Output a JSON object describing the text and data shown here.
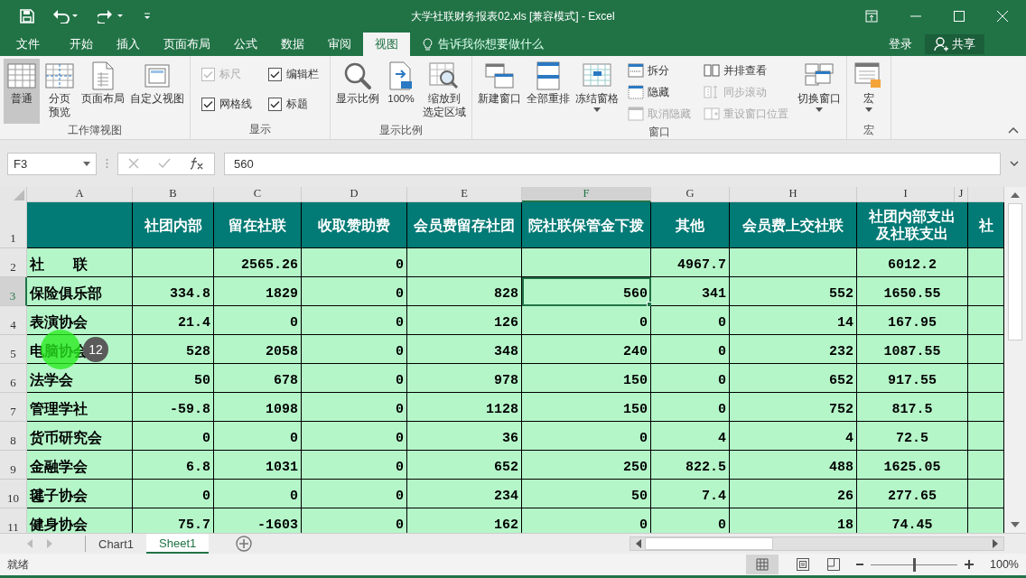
{
  "window": {
    "title": "大学社联财务报表02.xls  [兼容模式] - Excel",
    "sign_in": "登录",
    "share": "共享",
    "tell_me": "告诉我你想要做什么",
    "menu_tabs": [
      {
        "label": "文件",
        "selected": false
      },
      {
        "label": "开始",
        "selected": false
      },
      {
        "label": "插入",
        "selected": false
      },
      {
        "label": "页面布局",
        "selected": false
      },
      {
        "label": "公式",
        "selected": false
      },
      {
        "label": "数据",
        "selected": false
      },
      {
        "label": "审阅",
        "selected": false
      },
      {
        "label": "视图",
        "selected": true
      }
    ]
  },
  "ribbon": {
    "groups": [
      {
        "label": "工作簿视图",
        "items": [
          {
            "kind": "large",
            "label": "普通",
            "selected": true
          },
          {
            "kind": "large",
            "label": [
              "分页",
              "预览"
            ],
            "selected": false
          },
          {
            "kind": "large",
            "label": "页面布局",
            "selected": false
          },
          {
            "kind": "large",
            "label": "自定义视图",
            "selected": false
          }
        ]
      },
      {
        "label": "显示",
        "items": [
          {
            "kind": "check",
            "label": "标尺",
            "checked": true,
            "disabled": true
          },
          {
            "kind": "check",
            "label": "网格线",
            "checked": true,
            "disabled": false
          },
          {
            "kind": "check",
            "label": "编辑栏",
            "checked": true,
            "disabled": false
          },
          {
            "kind": "check",
            "label": "标题",
            "checked": true,
            "disabled": false
          }
        ]
      },
      {
        "label": "显示比例",
        "items": [
          {
            "kind": "large",
            "label": "显示比例",
            "selected": false
          },
          {
            "kind": "large",
            "label": "100%",
            "selected": false
          },
          {
            "kind": "large",
            "label": [
              "缩放到",
              "选定区域"
            ],
            "selected": false
          }
        ]
      },
      {
        "label": "窗口",
        "items": [
          {
            "kind": "large",
            "label": "新建窗口",
            "selected": false
          },
          {
            "kind": "large",
            "label": "全部重排",
            "selected": false
          },
          {
            "kind": "large",
            "label": "冻结窗格",
            "selected": false,
            "dropdown": true
          },
          {
            "kind": "small",
            "label": "拆分",
            "disabled": false
          },
          {
            "kind": "small",
            "label": "隐藏",
            "disabled": false
          },
          {
            "kind": "small",
            "label": "取消隐藏",
            "disabled": true
          },
          {
            "kind": "small",
            "label": "并排查看",
            "disabled": false
          },
          {
            "kind": "small",
            "label": "同步滚动",
            "disabled": true
          },
          {
            "kind": "small",
            "label": "重设窗口位置",
            "disabled": true
          },
          {
            "kind": "large",
            "label": "切换窗口",
            "selected": false,
            "dropdown": true
          }
        ]
      },
      {
        "label": "宏",
        "items": [
          {
            "kind": "large",
            "label": "宏",
            "selected": false,
            "dropdown": true
          }
        ]
      }
    ]
  },
  "formula_bar": {
    "name_box": "F3",
    "value": "560"
  },
  "sheet": {
    "columns": [
      {
        "letter": "A",
        "selected": false
      },
      {
        "letter": "B",
        "selected": false
      },
      {
        "letter": "C",
        "selected": false
      },
      {
        "letter": "D",
        "selected": false
      },
      {
        "letter": "E",
        "selected": false
      },
      {
        "letter": "F",
        "selected": true
      },
      {
        "letter": "G",
        "selected": false
      },
      {
        "letter": "H",
        "selected": false
      },
      {
        "letter": "I",
        "selected": false
      },
      {
        "letter": "J",
        "selected": false
      }
    ],
    "rows": [
      {
        "number": "1",
        "kind": "header",
        "selected": false,
        "cells": [
          null,
          "社团内部",
          "留在社联",
          "收取赞助费",
          "会员费留存社团",
          "院社联保管金下拨",
          "其他",
          "会员费上交社联",
          [
            "社团内部支出",
            "及社联支出"
          ],
          "社"
        ]
      },
      {
        "number": "2",
        "kind": "data",
        "selected": false,
        "cells": [
          "社　　联",
          null,
          "2565.26",
          "0",
          null,
          null,
          "4967.7",
          null,
          "6012.2"
        ]
      },
      {
        "number": "3",
        "kind": "data",
        "selected": true,
        "cells": [
          "保险俱乐部",
          "334.8",
          "1829",
          "0",
          "828",
          "560",
          "341",
          "552",
          "1650.55"
        ]
      },
      {
        "number": "4",
        "kind": "data",
        "selected": false,
        "cells": [
          "表演协会",
          "21.4",
          "0",
          "0",
          "126",
          "0",
          "0",
          "14",
          "167.95"
        ]
      },
      {
        "number": "5",
        "kind": "data",
        "selected": false,
        "cells": [
          "电脑协会",
          "528",
          "2058",
          "0",
          "348",
          "240",
          "0",
          "232",
          "1087.55"
        ]
      },
      {
        "number": "6",
        "kind": "data",
        "selected": false,
        "cells": [
          "法学会",
          "50",
          "678",
          "0",
          "978",
          "150",
          "0",
          "652",
          "917.55"
        ]
      },
      {
        "number": "7",
        "kind": "data",
        "selected": false,
        "cells": [
          "管理学社",
          "-59.8",
          "1098",
          "0",
          "1128",
          "150",
          "0",
          "752",
          "817.5"
        ]
      },
      {
        "number": "8",
        "kind": "data",
        "selected": false,
        "cells": [
          "货币研究会",
          "0",
          "0",
          "0",
          "36",
          "0",
          "4",
          "4",
          "72.5"
        ]
      },
      {
        "number": "9",
        "kind": "data",
        "selected": false,
        "cells": [
          "金融学会",
          "6.8",
          "1031",
          "0",
          "652",
          "250",
          "822.5",
          "488",
          "1625.05"
        ]
      },
      {
        "number": "10",
        "kind": "data",
        "selected": false,
        "cells": [
          "毽子协会",
          "0",
          "0",
          "0",
          "234",
          "50",
          "7.4",
          "26",
          "277.65"
        ]
      },
      {
        "number": "11",
        "kind": "data",
        "selected": false,
        "cells": [
          "健身协会",
          "75.7",
          "-1603",
          "0",
          "162",
          "0",
          "0",
          "18",
          "74.45"
        ]
      }
    ]
  },
  "click_marker": {
    "count": "12"
  },
  "sheet_tabs": [
    {
      "label": "Chart1",
      "selected": false
    },
    {
      "label": "Sheet1",
      "selected": true
    }
  ],
  "status_bar": {
    "status": "就绪",
    "zoom": {
      "level": 0.5,
      "reading": "100%"
    }
  }
}
